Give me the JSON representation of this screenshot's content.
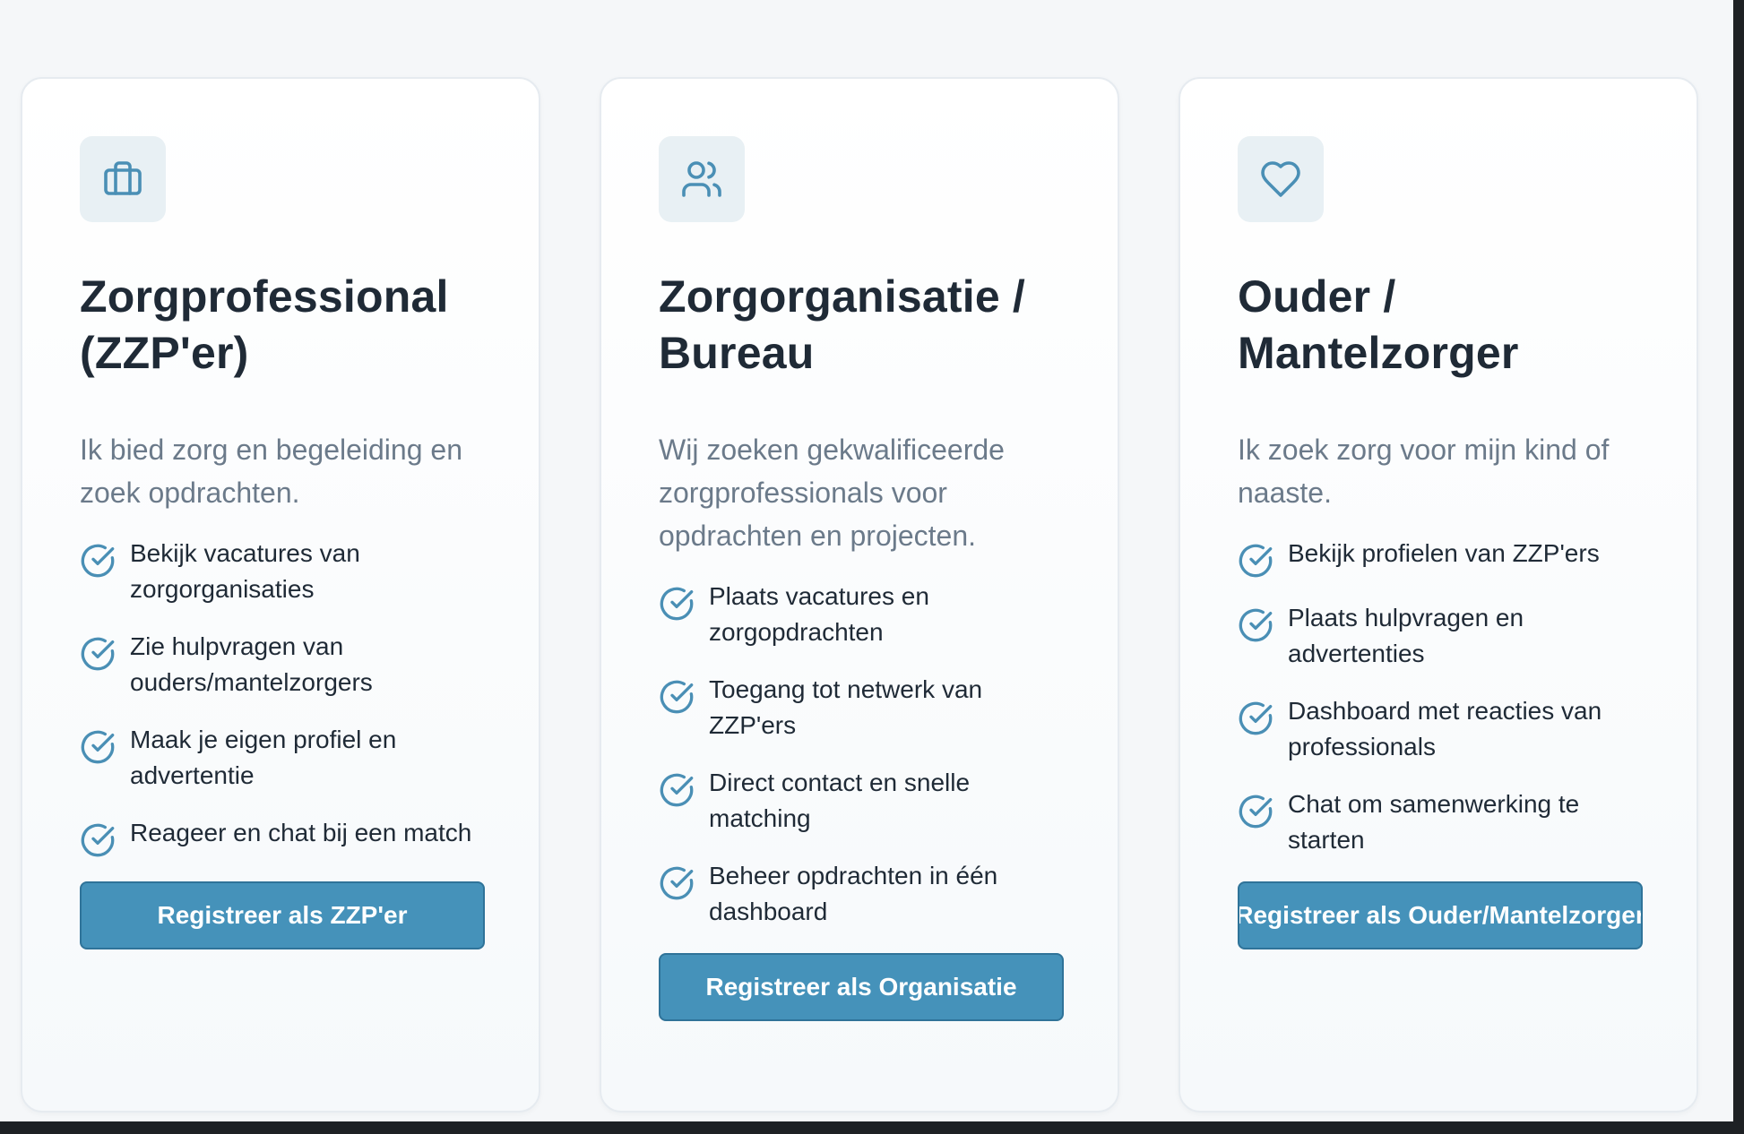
{
  "colors": {
    "accent": "#4592ba",
    "icon_stroke": "#4a8fb5",
    "icon_bg": "#e8f0f4",
    "title": "#1f2a36",
    "description": "#6b7a8a",
    "page_bg": "#f5f7f9"
  },
  "cards": [
    {
      "icon": "briefcase-icon",
      "title_line1": "Zorgprofessional",
      "title_line2": "(ZZP'er)",
      "description": "Ik bied zorg en begeleiding en zoek opdrachten.",
      "features": [
        "Bekijk vacatures van zorgorganisaties",
        "Zie hulpvragen van ouders/mantelzorgers",
        "Maak je eigen profiel en advertentie",
        "Reageer en chat bij een match"
      ],
      "button": "Registreer als ZZP'er"
    },
    {
      "icon": "users-icon",
      "title_line1": "Zorgorganisatie /",
      "title_line2": "Bureau",
      "description": "Wij zoeken gekwalificeerde zorgprofessionals voor opdrachten en projecten.",
      "features": [
        "Plaats vacatures en zorgopdrachten",
        "Toegang tot netwerk van ZZP'ers",
        "Direct contact en snelle matching",
        "Beheer opdrachten in één dashboard"
      ],
      "button": "Registreer als Organisatie"
    },
    {
      "icon": "heart-icon",
      "title_line1": "Ouder /",
      "title_line2": "Mantelzorger",
      "description": "Ik zoek zorg voor mijn kind of naaste.",
      "features": [
        "Bekijk profielen van ZZP'ers",
        "Plaats hulpvragen en advertenties",
        "Dashboard met reacties van professionals",
        "Chat om samenwerking te starten"
      ],
      "button": "Registreer als Ouder/Mantelzorger"
    }
  ]
}
